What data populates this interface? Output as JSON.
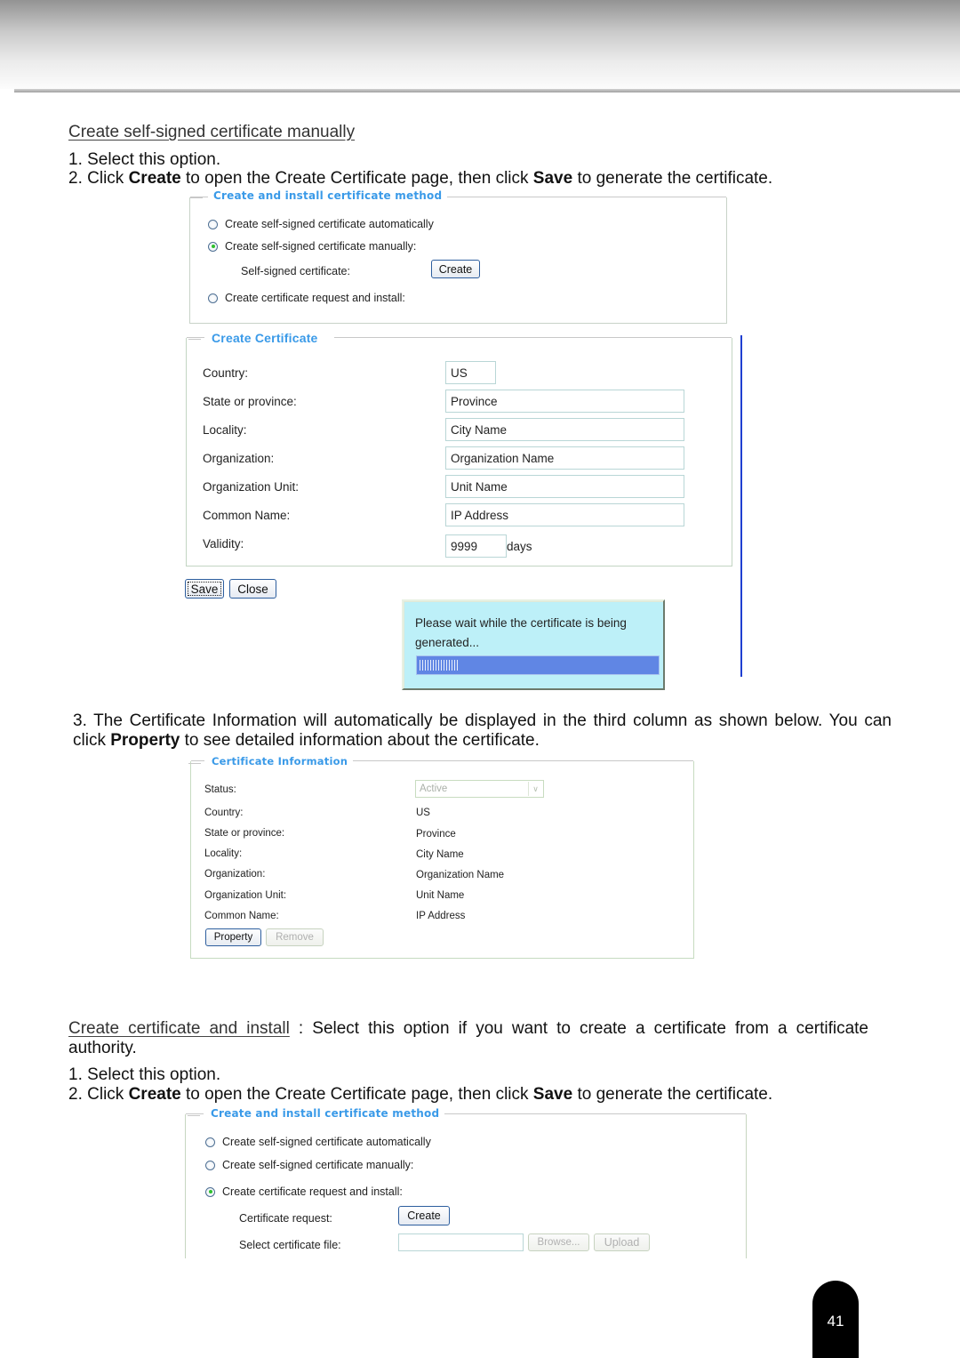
{
  "page_number": "41",
  "section1": {
    "heading": "Create self-signed certificate manually",
    "step1": "1. Select this option.",
    "step2": {
      "prefix": "2. Click ",
      "bold1": "Create",
      "middle": " to open the Create Certificate page, then click ",
      "bold2": "Save",
      "suffix": " to generate the certificate."
    },
    "method_panel": {
      "legend": "Create and install certificate method",
      "options": [
        {
          "label": "Create self-signed certificate automatically",
          "checked": false
        },
        {
          "label": "Create self-signed certificate manually:",
          "checked": true
        },
        {
          "label": "Create certificate request and install:",
          "checked": false
        }
      ],
      "sub_label": "Self-signed certificate:",
      "create_button": "Create"
    },
    "create_cert_panel": {
      "legend": "Create Certificate",
      "fields": [
        {
          "label": "Country:",
          "value": "US"
        },
        {
          "label": "State or province:",
          "value": "Province"
        },
        {
          "label": "Locality:",
          "value": "City Name"
        },
        {
          "label": "Organization:",
          "value": "Organization Name"
        },
        {
          "label": "Organization Unit:",
          "value": "Unit Name"
        },
        {
          "label": "Common Name:",
          "value": "IP Address"
        },
        {
          "label": "Validity:",
          "value": "9999"
        }
      ],
      "validity_unit": "days",
      "save_button": "Save",
      "close_button": "Close"
    },
    "wait_dialog": {
      "message": "Please wait while the certificate is being generated...",
      "progress_fraction": 0.16
    }
  },
  "step3": {
    "prefix": "3. The Certificate Information will automatically be displayed in the third column as shown below. You can click ",
    "bold": "Property",
    "suffix": " to see detailed information about the certificate."
  },
  "cert_info_panel": {
    "legend": "Certificate Information",
    "status_label": "Status:",
    "status_value": "Active",
    "rows": [
      {
        "label": "Country:",
        "value": "US"
      },
      {
        "label": "State or province:",
        "value": "Province"
      },
      {
        "label": "Locality:",
        "value": "City Name"
      },
      {
        "label": "Organization:",
        "value": "Organization Name"
      },
      {
        "label": "Organization Unit:",
        "value": "Unit Name"
      },
      {
        "label": "Common Name:",
        "value": "IP Address"
      }
    ],
    "property_button": "Property",
    "remove_button": "Remove"
  },
  "section2": {
    "heading": "Create certificate and install",
    "description": " :  Select this option if you want to create a certificate from a certificate authority.",
    "step1": "1. Select this option.",
    "step2": {
      "prefix": "2. Click ",
      "bold1": "Create",
      "middle": " to open the Create Certificate page, then click ",
      "bold2": "Save",
      "suffix": " to generate the certificate."
    },
    "method_panel": {
      "legend": "Create and install certificate method",
      "options": [
        {
          "label": "Create self-signed certificate automatically",
          "checked": false
        },
        {
          "label": "Create self-signed certificate manually:",
          "checked": false
        },
        {
          "label": "Create certificate request and install:",
          "checked": true
        }
      ],
      "request_label": "Certificate request:",
      "create_button": "Create",
      "file_label": "Select certificate file:",
      "file_value": "",
      "browse_button": "Browse...",
      "upload_button": "Upload"
    }
  }
}
